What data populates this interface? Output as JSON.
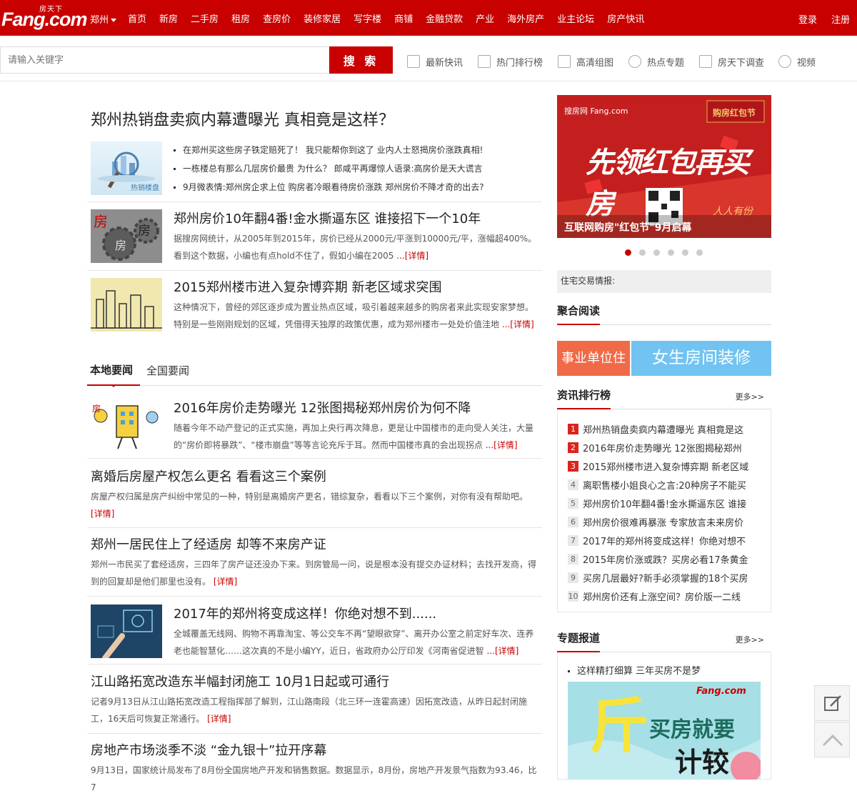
{
  "topbar": {
    "logo_sub": "房天下",
    "logo_main": "Fang.com",
    "city": "郑州",
    "nav": [
      "首页",
      "新房",
      "二手房",
      "租房",
      "查房价",
      "装修家居",
      "写字楼",
      "商铺",
      "金融贷款",
      "产业",
      "海外房产",
      "业主论坛",
      "房产快讯"
    ],
    "login": "登录",
    "register": "注册"
  },
  "search": {
    "placeholder": "请输入关键字",
    "button": "搜 索",
    "quick_links": [
      {
        "label": "最新快讯",
        "icon": "news-list-icon"
      },
      {
        "label": "热门排行榜",
        "icon": "ranking-icon"
      },
      {
        "label": "高清组图",
        "icon": "image-gallery-icon"
      },
      {
        "label": "热点专题",
        "icon": "fire-icon"
      },
      {
        "label": "房天下调查",
        "icon": "survey-edit-icon"
      },
      {
        "label": "视频",
        "icon": "play-video-icon"
      }
    ]
  },
  "headline": {
    "title": "郑州热销盘卖疯内幕遭曝光 真相竟是这样？",
    "thumb_caption": "热销楼盘",
    "bullets": [
      "在郑州买这些房子铁定赔死了！ 我只能帮你到这了 业内人士怒揭房价涨跌真相!",
      "一栋楼总有那么几层房价最贵 为什么？ 郎咸平再爆惊人语录:高房价是天大谎言",
      "9月微表情:郑州房企求上位 购房者冷眼看待房价涨跌 郑州房价不降才奇的出去?"
    ]
  },
  "top_articles": [
    {
      "title": "郑州房价10年翻4番!金水撕逼东区 谁接招下一个10年",
      "desc": "据搜房网统计，从2005年到2015年，房价已经从2000元/平涨到10000元/平，涨幅超400%。看到这个数据，小编也有点hold不住了，假如小编在2005",
      "more": "...[详情]"
    },
    {
      "title": "2015郑州楼市进入复杂博弈期 新老区域求突围",
      "desc": "这种情况下，曾经的郊区逐步成为置业热点区域，吸引着越来越多的购房者来此实现安家梦想。特别是一些刚刚规划的区域，凭借得天独厚的政策优惠，成为郑州楼市一处处价值洼地",
      "more": "...[详情]"
    }
  ],
  "tabs": {
    "local": "本地要闻",
    "national": "全国要闻"
  },
  "news": [
    {
      "title": "2016年房价走势曝光 12张图揭秘郑州房价为何不降",
      "desc": "随着今年不动产登记的正式实施，再加上央行再次降息，更是让中国楼市的走向受人关注，大量的“房价即将暴跌”、“楼市崩盘”等等言论充斥于耳。然而中国楼市真的会出现拐点",
      "more": "...[详情]"
    },
    {
      "title": "离婚后房屋产权怎么更名 看看这三个案例",
      "desc": "房屋产权归属是房产纠纷中常见的一种，特别是离婚房产更名，错综复杂，看看以下三个案例，对你有没有帮助吧。",
      "more": "[详情]"
    },
    {
      "title": "郑州一居民住上了经适房 却等不来房产证",
      "desc": "郑州一市民买了套经适房，三四年了房产证还没办下来。到房管局一问，说是根本没有提交办证材料；去找开发商，得到的回复却是他们那里也没有。",
      "more": "[详情]"
    },
    {
      "title": "2017年的郑州将变成这样！你绝对想不到......",
      "desc": "全城覆盖无线网、购物不再靠淘宝、等公交车不再“望眼欲穿”、离开办公室之前定好车次、连养老也能智慧化……这次真的不是小编YY，近日，省政府办公厅印发《河南省促进智",
      "more": "...[详情]"
    },
    {
      "title": "江山路拓宽改造东半幅封闭施工 10月1日起或可通行",
      "desc": "记者9月13日从江山路拓宽改造工程指挥部了解到，江山路南段（北三环一连霍高速）因拓宽改造，从昨日起封闭施工，16天后可恢复正常通行。",
      "more": "[详情]"
    },
    {
      "title": "房地产市场淡季不淡 “金九银十”拉开序幕",
      "desc": "9月13日，国家统计局发布了8月份全国房地产开发和销售数据。数据显示，8月份，房地产开发景气指数为93.46，比7",
      "more": ""
    }
  ],
  "banner": {
    "brand": "搜房网 Fang.com",
    "corner": "购房红包节",
    "slogan": "先领红包再买房",
    "caption": "互联网购房\"红包节\"9月启幕",
    "tagline": "人人有份",
    "slide_count": 6,
    "active_slide": 1
  },
  "sidebar": {
    "trade_info": "住宅交易情报:",
    "reading_title": "聚合阅读",
    "tags": [
      "事业单位住",
      "女生房间装修"
    ],
    "ranking_title": "资讯排行榜",
    "ranking_more": "更多>>",
    "ranking": [
      "郑州热销盘卖疯内幕遭曝光 真相竟是这",
      "2016年房价走势曝光 12张图揭秘郑州",
      "2015郑州楼市进入复杂博弈期 新老区域",
      "离职售楼小姐良心之言:20种房子不能买",
      "郑州房价10年翻4番!金水撕逼东区 谁接",
      "郑州房价很难再暴涨 专家放言未来房价",
      "2017年的郑州将变成这样！你绝对想不",
      "2015年房价涨或跌？买房必看17条黄金",
      "买房几层最好?新手必须掌握的18个买房",
      "郑州房价还有上涨空间？房价版一二线"
    ],
    "topic_title": "专题报道",
    "topic_more": "更多>>",
    "topic_item": "这样精打细算 三年买房不是梦",
    "topic_img_brand": "Fang.com",
    "topic_img_big": "斤",
    "topic_img_text1": "买房就要",
    "topic_img_text2": "计较"
  },
  "colors": {
    "brand_red": "#c90000",
    "tag_orange": "#f06a48",
    "tag_blue": "#72c3f1"
  }
}
